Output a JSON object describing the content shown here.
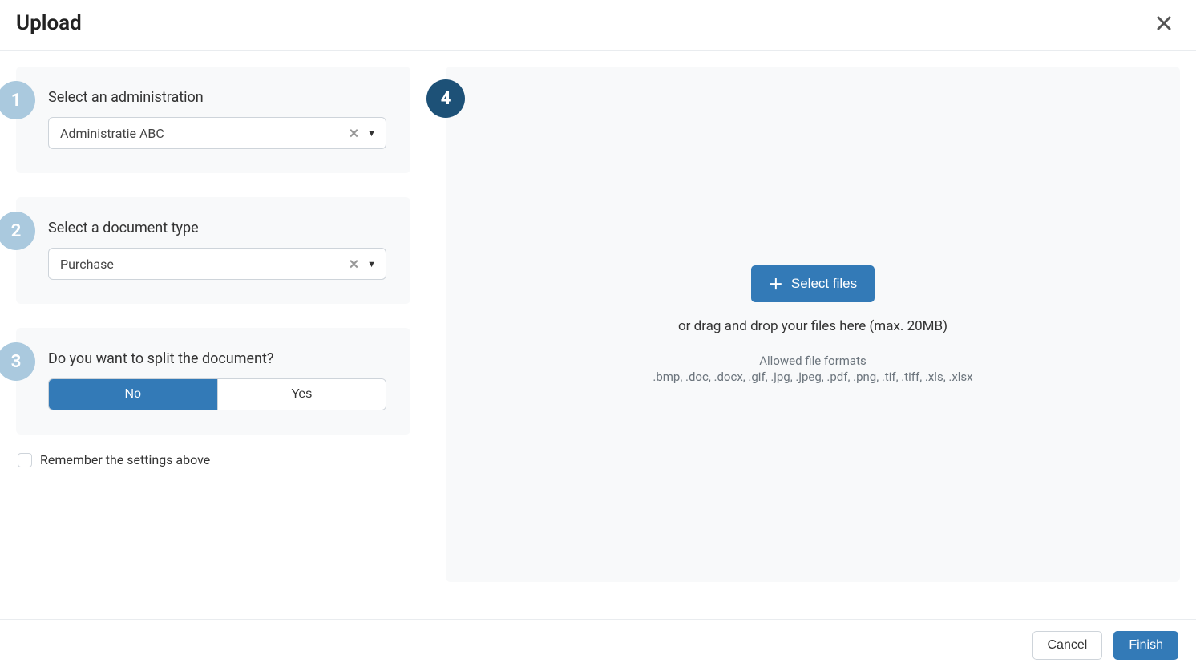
{
  "header": {
    "title": "Upload"
  },
  "steps": {
    "s1": {
      "number": "1",
      "title": "Select an administration",
      "value": "Administratie ABC"
    },
    "s2": {
      "number": "2",
      "title": "Select a document type",
      "value": "Purchase"
    },
    "s3": {
      "number": "3",
      "title": "Do you want to split the document?",
      "no": "No",
      "yes": "Yes",
      "selected": "No"
    },
    "s4": {
      "number": "4"
    }
  },
  "remember": {
    "label": "Remember the settings above",
    "checked": false
  },
  "upload": {
    "button": "Select files",
    "drop_hint": "or drag and drop your files here (max. 20MB)",
    "allowed_title": "Allowed file formats",
    "allowed_formats": ".bmp, .doc, .docx, .gif, .jpg, .jpeg, .pdf, .png, .tif, .tiff, .xls, .xlsx"
  },
  "footer": {
    "cancel": "Cancel",
    "finish": "Finish"
  }
}
